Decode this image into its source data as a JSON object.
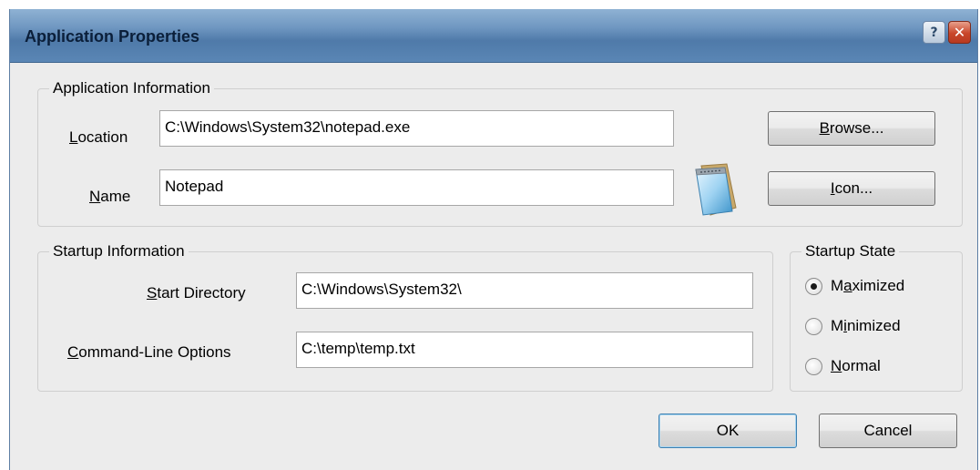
{
  "window": {
    "title": "Application Properties",
    "help_glyph": "?",
    "close_glyph": "✕"
  },
  "app_info": {
    "group_label": "Application Information",
    "location": {
      "accel": "L",
      "label_rest": "ocation",
      "value": "C:\\Windows\\System32\\notepad.exe"
    },
    "name": {
      "accel": "N",
      "label_rest": "ame",
      "value": "Notepad"
    },
    "app_icon": "notepad-icon",
    "browse_button": {
      "accel": "B",
      "label_rest": "rowse..."
    },
    "icon_button": {
      "accel": "I",
      "label_rest": "con..."
    }
  },
  "startup_info": {
    "group_label": "Startup Information",
    "start_directory": {
      "accel": "S",
      "label_rest": "tart Directory",
      "value": "C:\\Windows\\System32\\"
    },
    "command_line": {
      "accel": "C",
      "label_rest": "ommand-Line Options",
      "value": "C:\\temp\\temp.txt"
    }
  },
  "startup_state": {
    "group_label": "Startup State",
    "options": [
      {
        "pre": "M",
        "accel": "a",
        "post": "ximized",
        "selected": true
      },
      {
        "pre": "M",
        "accel": "i",
        "post": "nimized",
        "selected": false
      },
      {
        "pre": "",
        "accel": "N",
        "post": "ormal",
        "selected": false
      }
    ]
  },
  "footer": {
    "ok_label": "OK",
    "cancel_label": "Cancel"
  },
  "colors": {
    "titlebar": "#5a86b5",
    "dialog_bg": "#ececec",
    "default_button_border": "#3c7fb1",
    "close_button": "#c9462a"
  }
}
